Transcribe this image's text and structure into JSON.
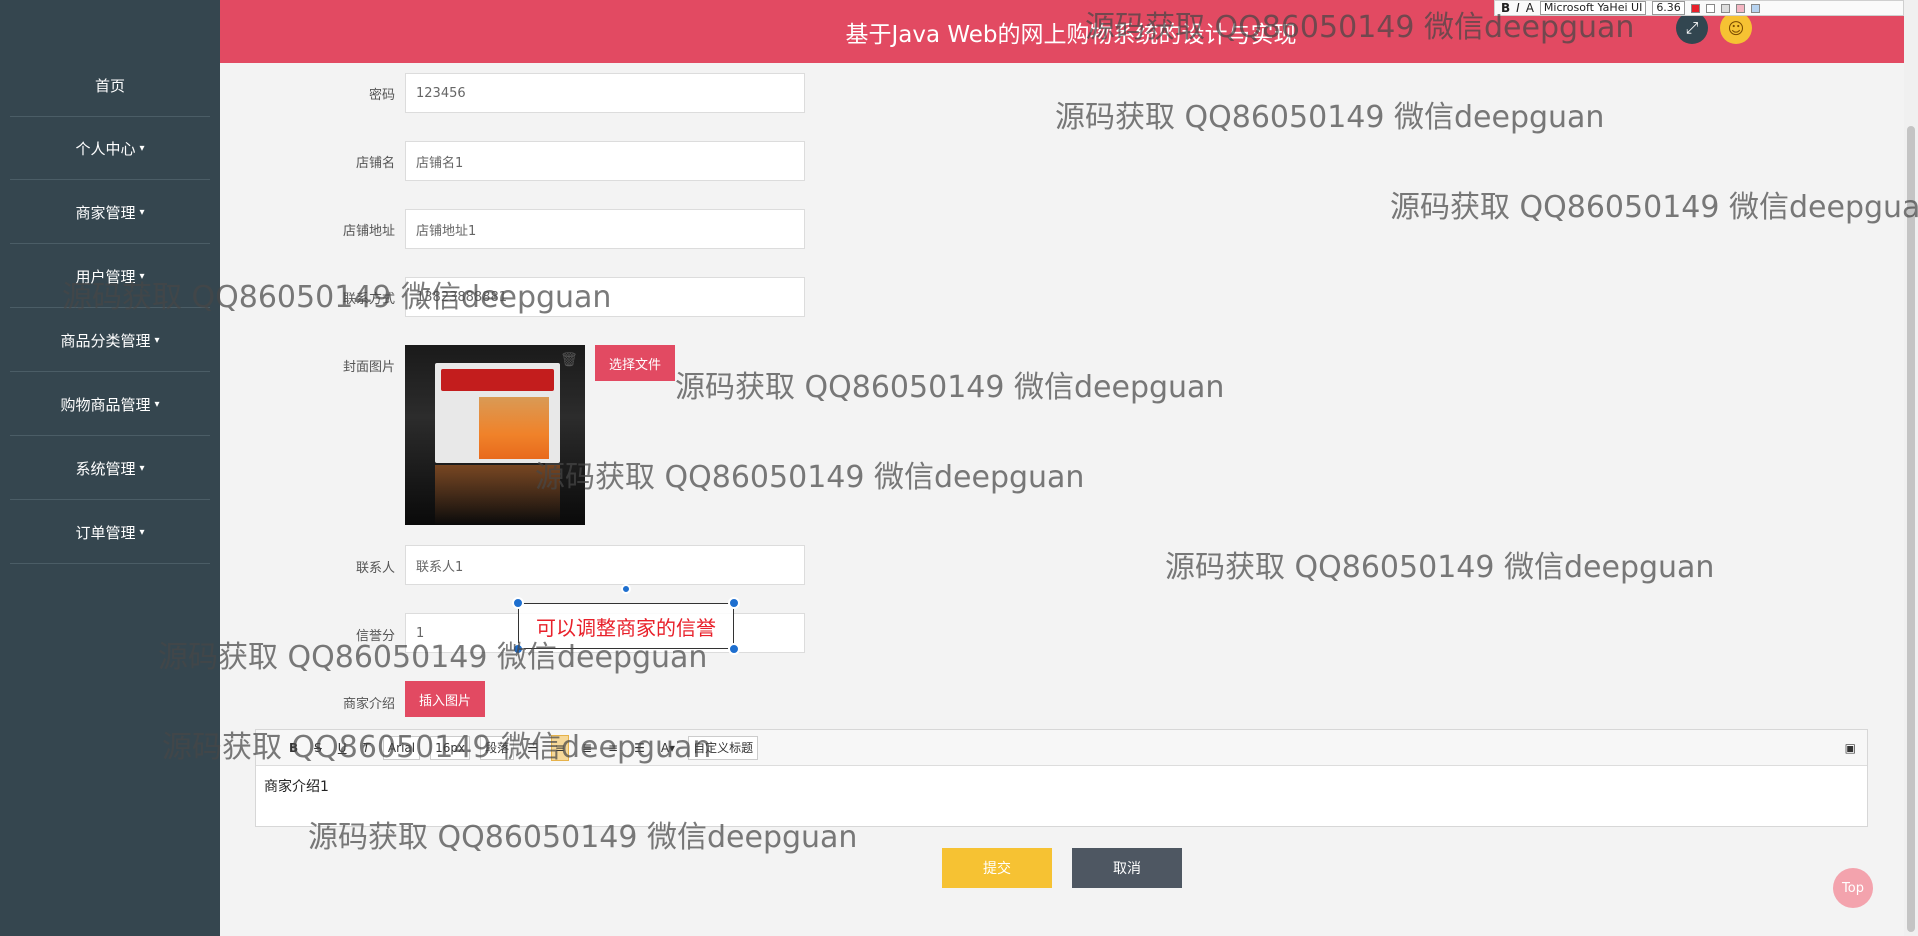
{
  "header": {
    "title": "基于Java Web的网上购物系统的设计与实现"
  },
  "sidebar": {
    "items": [
      {
        "label": "首页",
        "dropdown": false
      },
      {
        "label": "个人中心",
        "dropdown": true
      },
      {
        "label": "商家管理",
        "dropdown": true
      },
      {
        "label": "用户管理",
        "dropdown": true
      },
      {
        "label": "商品分类管理",
        "dropdown": true
      },
      {
        "label": "购物商品管理",
        "dropdown": true
      },
      {
        "label": "系统管理",
        "dropdown": true
      },
      {
        "label": "订单管理",
        "dropdown": true
      }
    ]
  },
  "form": {
    "password": {
      "label": "密码",
      "value": "123456"
    },
    "shop_name": {
      "label": "店铺名",
      "value": "店铺名1"
    },
    "shop_address": {
      "label": "店铺地址",
      "value": "店铺地址1"
    },
    "contact_phone": {
      "label": "联系方式",
      "value": "13823888881"
    },
    "cover": {
      "label": "封面图片",
      "choose_file": "选择文件"
    },
    "contact_person": {
      "label": "联系人",
      "value": "联系人1"
    },
    "credit": {
      "label": "信誉分",
      "value": "1"
    },
    "intro": {
      "label": "商家介绍",
      "insert_image": "插入图片",
      "content": "商家介绍1"
    }
  },
  "editor_toolbar": {
    "font": "Arial",
    "size": "16px",
    "block": "段落",
    "custom_title": "自定义标题"
  },
  "actions": {
    "submit": "提交",
    "cancel": "取消",
    "top": "Top"
  },
  "annotation": {
    "text": "可以调整商家的信誉"
  },
  "format_toolbar": {
    "font": "Microsoft YaHei UI",
    "size": "6.36"
  },
  "watermark": {
    "text": "源码获取 QQ86050149 微信deepguan"
  },
  "colors": {
    "brand": "#e24a62",
    "sidebar": "#35464f",
    "submit": "#f6c233",
    "cancel": "#4e5762"
  }
}
